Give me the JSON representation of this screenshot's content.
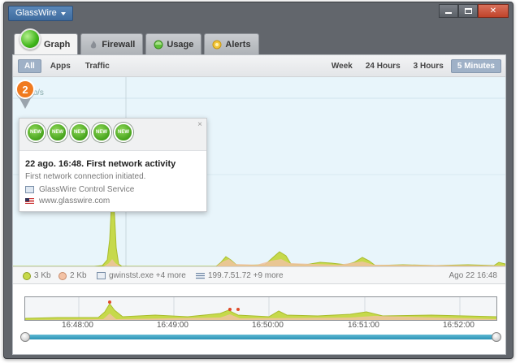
{
  "app": {
    "menu_label": "GlassWire"
  },
  "window_controls": {
    "minimize": "minimize",
    "maximize": "maximize",
    "close": "✕"
  },
  "tabs": [
    {
      "label": "Graph",
      "icon": "graph-ball-icon",
      "active": true
    },
    {
      "label": "Firewall",
      "icon": "firewall-icon"
    },
    {
      "label": "Usage",
      "icon": "usage-icon"
    },
    {
      "label": "Alerts",
      "icon": "alerts-icon"
    }
  ],
  "filters": {
    "all": "All",
    "apps": "Apps",
    "traffic": "Traffic"
  },
  "ranges": {
    "week": "Week",
    "h24": "24 Hours",
    "h3": "3 Hours",
    "m5": "5 Minutes",
    "selected": "5 Minutes"
  },
  "graph": {
    "y_label": "90 Kb/s"
  },
  "popup": {
    "badge_text": "NEW",
    "badge_count": 5,
    "close": "×",
    "title": "22 ago. 16:48. First network activity",
    "subtitle": "First network connection initiated.",
    "service": "GlassWire Control Service",
    "site": "www.glasswire.com"
  },
  "marker": {
    "count": "2"
  },
  "infobar": {
    "download": "3 Kb",
    "upload": "2 Kb",
    "process": "gwinstst.exe +4 more",
    "host": "199.7.51.72 +9 more",
    "timestamp": "Ago 22 16:48"
  },
  "timeline": {
    "ticks": [
      "16:48:00",
      "16:49:00",
      "16:50:00",
      "16:51:00",
      "16:52:00"
    ]
  },
  "colors": {
    "accent": "#3f6c9f",
    "download": "#c7d94a",
    "upload": "#f3c2a5",
    "graph_bg": "#e8f5fb",
    "slider": "#2c93b6"
  }
}
